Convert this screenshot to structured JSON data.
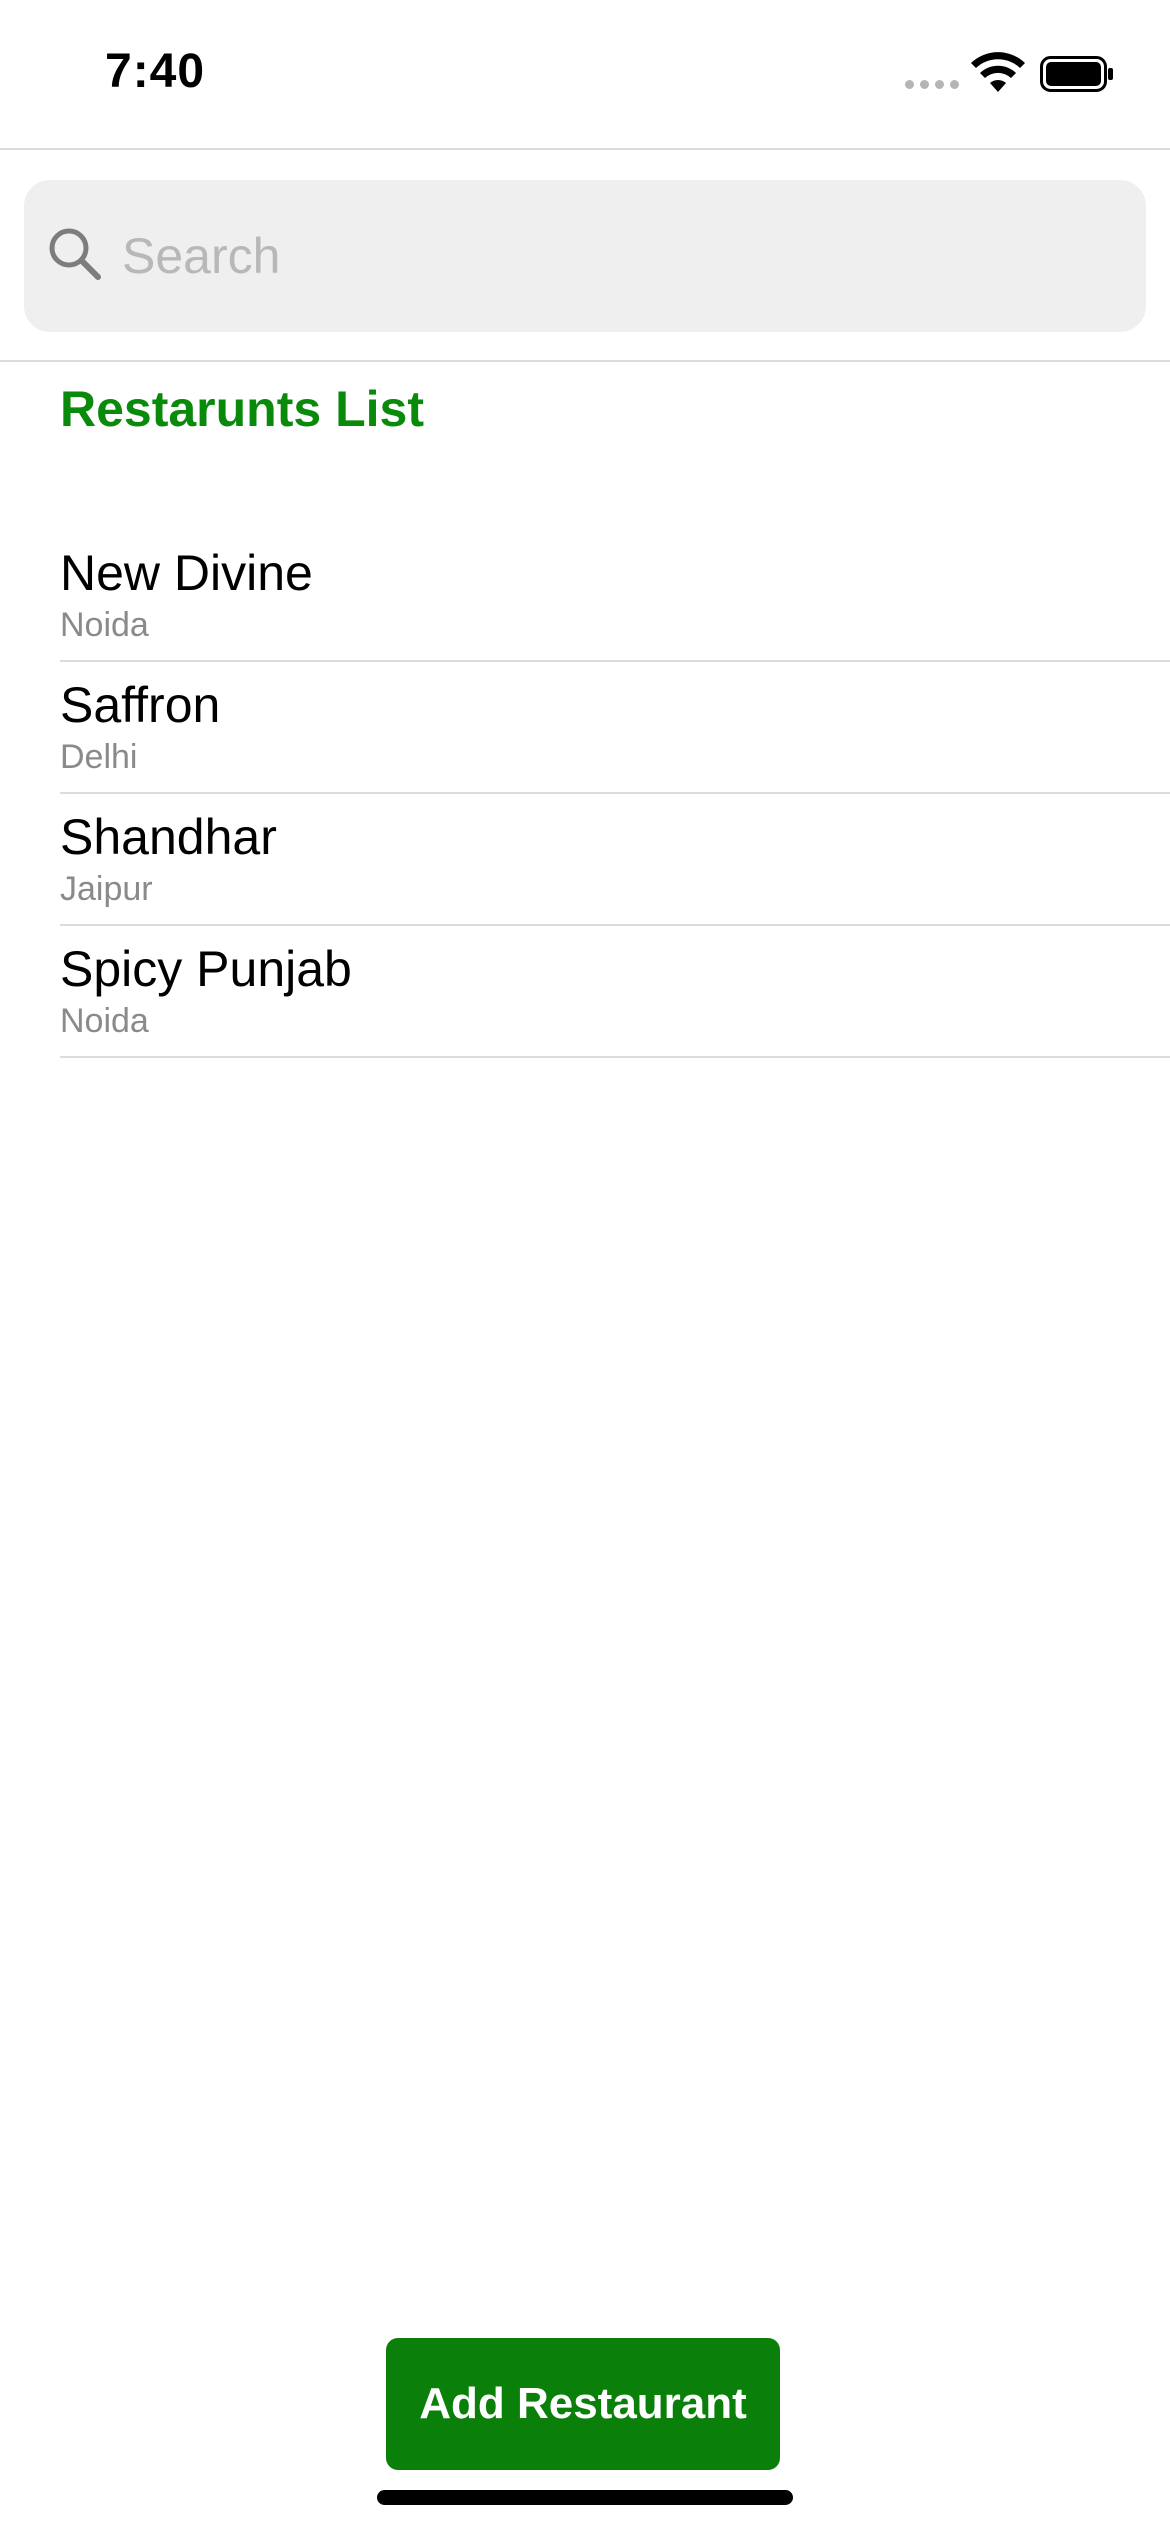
{
  "status_bar": {
    "time": "7:40",
    "icons": [
      "signal-icon",
      "wifi-icon",
      "battery-icon"
    ]
  },
  "search": {
    "placeholder": "Search",
    "value": ""
  },
  "section": {
    "title": "Restarunts List"
  },
  "restaurants": [
    {
      "name": "New Divine",
      "city": "Noida"
    },
    {
      "name": "Saffron",
      "city": "Delhi"
    },
    {
      "name": "Shandhar",
      "city": "Jaipur"
    },
    {
      "name": "Spicy Punjab",
      "city": "Noida"
    }
  ],
  "actions": {
    "add_label": "Add Restaurant"
  },
  "colors": {
    "accent": "#0a7f0a",
    "title_green": "#0a8a0a",
    "secondary_text": "#8a8a8a",
    "separator": "#dcdcdc",
    "search_bg": "#efefef"
  }
}
